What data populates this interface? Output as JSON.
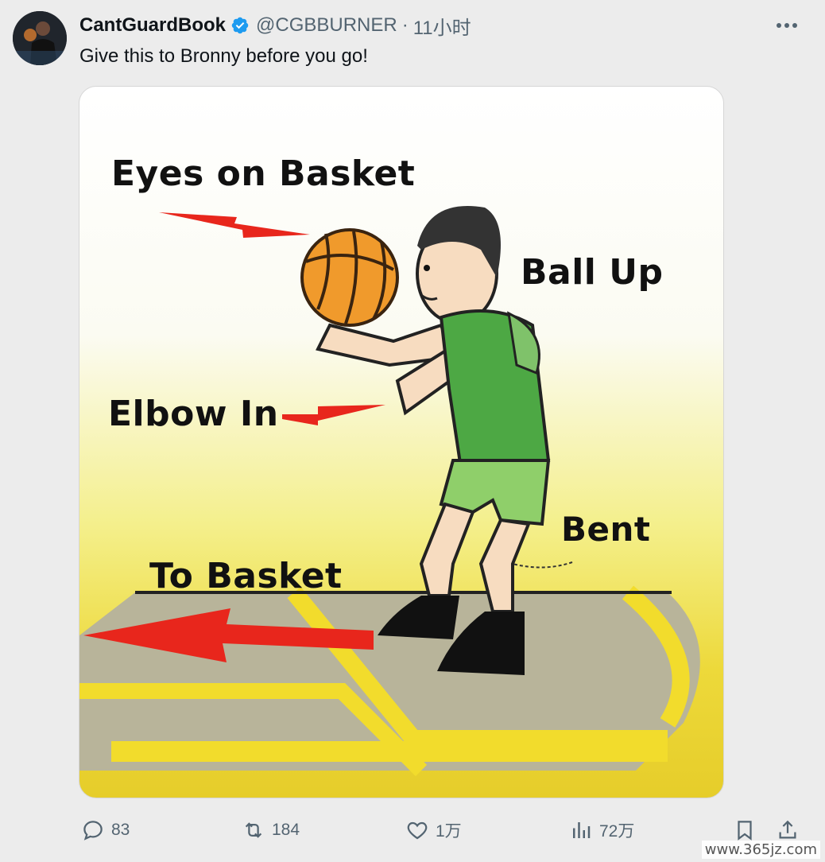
{
  "author": {
    "display_name": "CantGuardBook",
    "handle": "@CGBBURNER",
    "separator": "·",
    "time": "11小时"
  },
  "tweet": {
    "text": "Give this to Bronny before you go!"
  },
  "image_labels": {
    "eyes": "Eyes on Basket",
    "ball": "Ball Up",
    "elbow": "Elbow In",
    "bent": "Bent",
    "to_basket": "To Basket"
  },
  "actions": {
    "replies": "83",
    "retweets": "184",
    "likes": "1万",
    "views": "72万"
  },
  "watermark": "www.365jz.com",
  "colors": {
    "verified": "#1d9bf0",
    "meta_gray": "#536471",
    "arrow_red": "#e8261c",
    "court_yellow": "#f2dc2c",
    "jersey_green": "#4da844"
  }
}
